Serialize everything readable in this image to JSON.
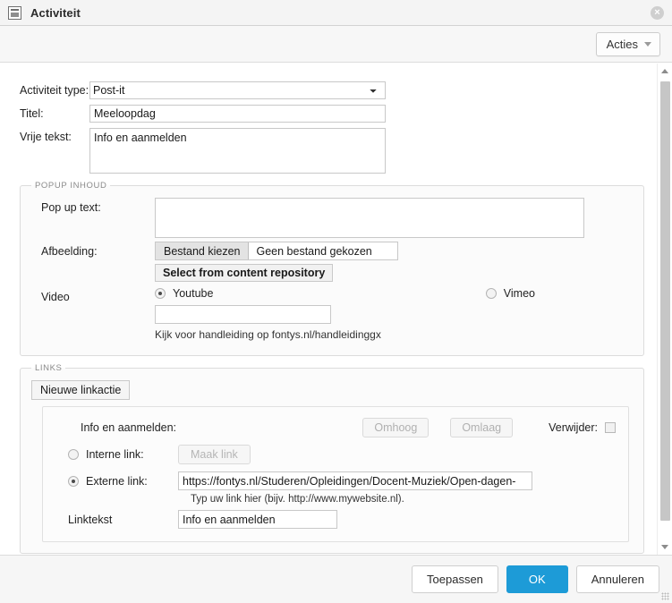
{
  "window": {
    "title": "Activiteit",
    "icon": "window-panel-icon",
    "close_label": "×"
  },
  "toolbar": {
    "acties_label": "Acties"
  },
  "form": {
    "activiteit_type": {
      "label": "Activiteit type:",
      "value": "Post-it"
    },
    "titel": {
      "label": "Titel:",
      "value": "Meeloopdag",
      "placeholder": ""
    },
    "vrije_tekst": {
      "label": "Vrije tekst:",
      "value": "Info en aanmelden",
      "placeholder": ""
    }
  },
  "popup": {
    "legend": "POPUP INHOUD",
    "pop_up_text": {
      "label": "Pop up text:",
      "value": "",
      "placeholder": ""
    },
    "afbeelding": {
      "label": "Afbeelding:",
      "choose_button": "Bestand kiezen",
      "file_status": "Geen bestand gekozen",
      "repository_button": "Select from content repository"
    },
    "video": {
      "label": "Video",
      "options": [
        {
          "label": "Youtube",
          "selected": true
        },
        {
          "label": "Vimeo",
          "selected": false
        }
      ],
      "url_value": "",
      "hint": "Kijk voor handleiding op fontys.nl/handleidinggx"
    }
  },
  "links": {
    "legend": "LINKS",
    "new_link_button": "Nieuwe linkactie",
    "card": {
      "title": "Info en aanmelden:",
      "move_up": "Omhoog",
      "move_down": "Omlaag",
      "delete_label": "Verwijder:",
      "internal": {
        "label": "Interne link:",
        "selected": false,
        "button": "Maak link"
      },
      "external": {
        "label": "Externe link:",
        "selected": true,
        "value": "https://fontys.nl/Studeren/Opleidingen/Docent-Muziek/Open-dagen-"
      },
      "hint": "Typ uw link hier (bijv. http://www.mywebsite.nl).",
      "linktekst": {
        "label": "Linktekst",
        "value": "Info en aanmelden"
      }
    }
  },
  "footer": {
    "apply": "Toepassen",
    "ok": "OK",
    "cancel": "Annuleren"
  },
  "colors": {
    "primary": "#1d9bd7",
    "titlebar": "#f4f4f4",
    "panel": "#fbfbfb"
  }
}
